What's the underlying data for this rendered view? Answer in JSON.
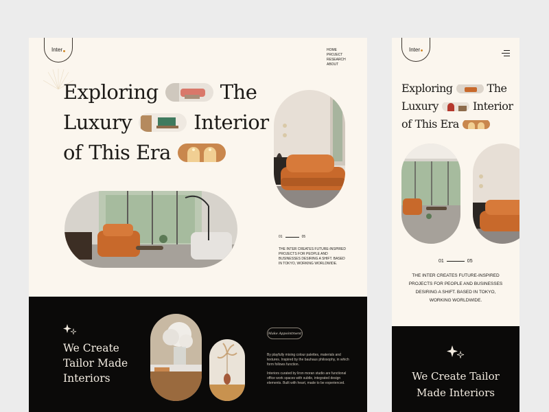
{
  "brand": {
    "name": "Inter"
  },
  "nav": [
    "HOME",
    "PROJECT",
    "RESEARCH",
    "ABOUT"
  ],
  "hero": {
    "line1": [
      "Exploring",
      "The"
    ],
    "line2": [
      "Luxury",
      "Interior"
    ],
    "line3": [
      "of",
      "This Era"
    ]
  },
  "counter": {
    "start": "01",
    "end": "05"
  },
  "description": "THE INTER CREATES FUTURE-INSPIRED PROJECTS FOR PEOPLE AND BUSINESSES DESIRING A SHIFT. BASED IN TOKYO, WORKING WORLDWIDE.",
  "dark_section": {
    "title_lines": [
      "We Create",
      "Tailor Made",
      "Interiors"
    ],
    "button": "Make Appointment",
    "paragraph1": "By playfully mixing colour palettes, materials and textures. Inspired by the bauhaus philosophy, in which form follows function.",
    "paragraph2": "Interiors curated by liron moran studio are functional office work spaces with subtle, integrated design elements. Built with heart, made to be experienced."
  },
  "mobile": {
    "hero": {
      "line1": [
        "Exploring",
        "The"
      ],
      "line2": [
        "Luxury",
        "Interior"
      ],
      "line3": [
        "of",
        "This Era"
      ]
    },
    "description_lines": [
      "THE INTER CREATES FUTURE-INSPIRED",
      "PROJECTS FOR PEOPLE AND BUSINESSES",
      "DESIRING A SHIFT. BASED IN TOKYO,",
      "WORKING WORLDWIDE."
    ],
    "dark_title_lines": [
      "We Create Tailor",
      "Made Interiors"
    ]
  },
  "colors": {
    "cream": "#fbf6ee",
    "black": "#0b0a09",
    "accent_orange": "#c8692b",
    "text_dark": "#1c1a17"
  }
}
